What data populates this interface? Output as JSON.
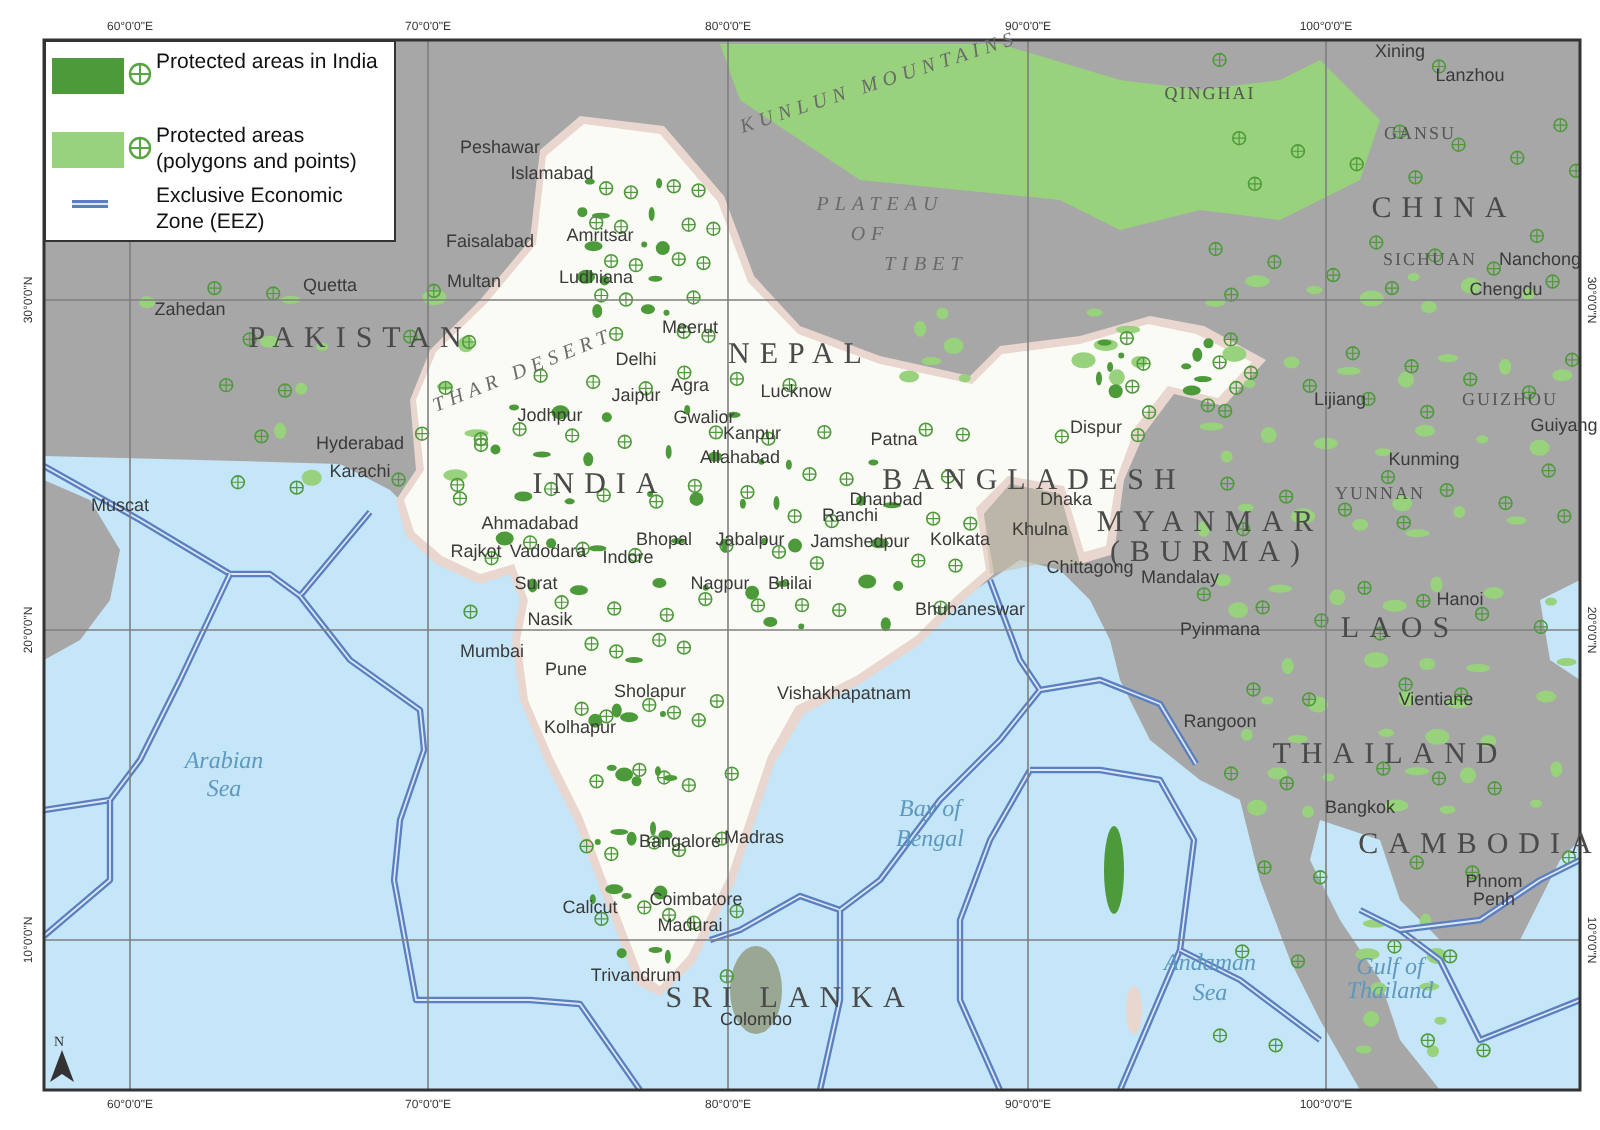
{
  "map": {
    "axis_labels": {
      "top": [
        "60°0'0\"E",
        "70°0'0\"E",
        "80°0'0\"E",
        "90°0'0\"E",
        "100°0'0\"E"
      ],
      "bottom": [
        "60°0'0\"E",
        "70°0'0\"E",
        "80°0'0\"E",
        "90°0'0\"E",
        "100°0'0\"E"
      ],
      "left": [
        "30°0'0\"N",
        "20°0'0\"N",
        "10°0'0\"N"
      ],
      "right": [
        "30°0'0\"N",
        "20°0'0\"N",
        "10°0'0\"N"
      ]
    },
    "labels": [
      {
        "text": "PAKISTAN",
        "kind": "country"
      },
      {
        "text": "INDIA",
        "kind": "country"
      },
      {
        "text": "CHINA",
        "kind": "country"
      },
      {
        "text": "NEPAL",
        "kind": "country"
      },
      {
        "text": "BANGLADESH",
        "kind": "country"
      },
      {
        "text": "MYANMAR",
        "kind": "country"
      },
      {
        "text": "(BURMA)",
        "kind": "country"
      },
      {
        "text": "LAOS",
        "kind": "country"
      },
      {
        "text": "THAILAND",
        "kind": "country"
      },
      {
        "text": "CAMBODIA",
        "kind": "country"
      },
      {
        "text": "SRI LANKA",
        "kind": "country"
      },
      {
        "text": "QINGHAI",
        "kind": "region"
      },
      {
        "text": "GANSU",
        "kind": "region"
      },
      {
        "text": "SICHUAN",
        "kind": "region"
      },
      {
        "text": "YUNNAN",
        "kind": "region"
      },
      {
        "text": "GUIZHOU",
        "kind": "region"
      },
      {
        "text": "PLATEAU",
        "kind": "plateau"
      },
      {
        "text": "OF",
        "kind": "plateau"
      },
      {
        "text": "TIBET",
        "kind": "plateau"
      },
      {
        "text": "KUNLUN MOUNTAINS",
        "kind": "mountain"
      },
      {
        "text": "THAR DESERT",
        "kind": "desert"
      },
      {
        "text": "Arabian",
        "kind": "sea"
      },
      {
        "text": "Sea",
        "kind": "sea"
      },
      {
        "text": "Bay of",
        "kind": "sea"
      },
      {
        "text": "Bengal",
        "kind": "sea"
      },
      {
        "text": "Andaman",
        "kind": "sea"
      },
      {
        "text": "Sea",
        "kind": "sea"
      },
      {
        "text": "Gulf of",
        "kind": "sea"
      },
      {
        "text": "Thailand",
        "kind": "sea"
      },
      {
        "text": "Peshawar",
        "kind": "city"
      },
      {
        "text": "Islamabad",
        "kind": "city"
      },
      {
        "text": "Faisalabad",
        "kind": "city"
      },
      {
        "text": "Amritsar",
        "kind": "city"
      },
      {
        "text": "Multan",
        "kind": "city"
      },
      {
        "text": "Ludhiana",
        "kind": "city"
      },
      {
        "text": "Quetta",
        "kind": "city"
      },
      {
        "text": "Zahedan",
        "kind": "city"
      },
      {
        "text": "Hyderabad",
        "kind": "city"
      },
      {
        "text": "Karachi",
        "kind": "city"
      },
      {
        "text": "Muscat",
        "kind": "city"
      },
      {
        "text": "Meerut",
        "kind": "city"
      },
      {
        "text": "Delhi",
        "kind": "city"
      },
      {
        "text": "Jaipur",
        "kind": "city"
      },
      {
        "text": "Agra",
        "kind": "city"
      },
      {
        "text": "Jodhpur",
        "kind": "city"
      },
      {
        "text": "Gwalior",
        "kind": "city"
      },
      {
        "text": "Kanpur",
        "kind": "city"
      },
      {
        "text": "Lucknow",
        "kind": "city"
      },
      {
        "text": "Allahabad",
        "kind": "city"
      },
      {
        "text": "Ahmadabad",
        "kind": "city"
      },
      {
        "text": "Rajkot",
        "kind": "city"
      },
      {
        "text": "Vadodara",
        "kind": "city"
      },
      {
        "text": "Indore",
        "kind": "city"
      },
      {
        "text": "Bhopal",
        "kind": "city"
      },
      {
        "text": "Jabalpur",
        "kind": "city"
      },
      {
        "text": "Surat",
        "kind": "city"
      },
      {
        "text": "Nagpur",
        "kind": "city"
      },
      {
        "text": "Bhilai",
        "kind": "city"
      },
      {
        "text": "Nasik",
        "kind": "city"
      },
      {
        "text": "Mumbai",
        "kind": "city"
      },
      {
        "text": "Pune",
        "kind": "city"
      },
      {
        "text": "Sholapur",
        "kind": "city"
      },
      {
        "text": "Kolhapur",
        "kind": "city"
      },
      {
        "text": "Patna",
        "kind": "city"
      },
      {
        "text": "Dhanbad",
        "kind": "city"
      },
      {
        "text": "Ranchi",
        "kind": "city"
      },
      {
        "text": "Jamshedpur",
        "kind": "city"
      },
      {
        "text": "Kolkata",
        "kind": "city"
      },
      {
        "text": "Bhubaneswar",
        "kind": "city"
      },
      {
        "text": "Vishakhapatnam",
        "kind": "city"
      },
      {
        "text": "Bangalore",
        "kind": "city"
      },
      {
        "text": "Madras",
        "kind": "city"
      },
      {
        "text": "Calicut",
        "kind": "city"
      },
      {
        "text": "Coimbatore",
        "kind": "city"
      },
      {
        "text": "Madurai",
        "kind": "city"
      },
      {
        "text": "Trivandrum",
        "kind": "city"
      },
      {
        "text": "Colombo",
        "kind": "city"
      },
      {
        "text": "Dispur",
        "kind": "city"
      },
      {
        "text": "Dhaka",
        "kind": "city"
      },
      {
        "text": "Khulna",
        "kind": "city"
      },
      {
        "text": "Chittagong",
        "kind": "city"
      },
      {
        "text": "Mandalay",
        "kind": "city"
      },
      {
        "text": "Pyinmana",
        "kind": "city"
      },
      {
        "text": "Rangoon",
        "kind": "city"
      },
      {
        "text": "Hanoi",
        "kind": "city"
      },
      {
        "text": "Vientiane",
        "kind": "city"
      },
      {
        "text": "Bangkok",
        "kind": "city"
      },
      {
        "text": "Phnom",
        "kind": "city"
      },
      {
        "text": "Penh",
        "kind": "city"
      },
      {
        "text": "Lijiang",
        "kind": "city"
      },
      {
        "text": "Kunming",
        "kind": "city"
      },
      {
        "text": "Nanchong",
        "kind": "city"
      },
      {
        "text": "Chengdu",
        "kind": "city"
      },
      {
        "text": "Guiyang",
        "kind": "city"
      },
      {
        "text": "Xining",
        "kind": "city"
      },
      {
        "text": "Lanzhou",
        "kind": "city"
      }
    ],
    "north_arrow": {
      "label": "N"
    }
  },
  "legend": {
    "items": [
      {
        "kind": "area",
        "label": "Protected areas in India",
        "color": "#4c9a3a"
      },
      {
        "kind": "area",
        "label": "Protected areas (polygons and points)",
        "color": "#98d27c"
      },
      {
        "kind": "line",
        "label": "Exclusive Economic Zone (EEZ)",
        "color": "#5b7fbf"
      }
    ]
  }
}
